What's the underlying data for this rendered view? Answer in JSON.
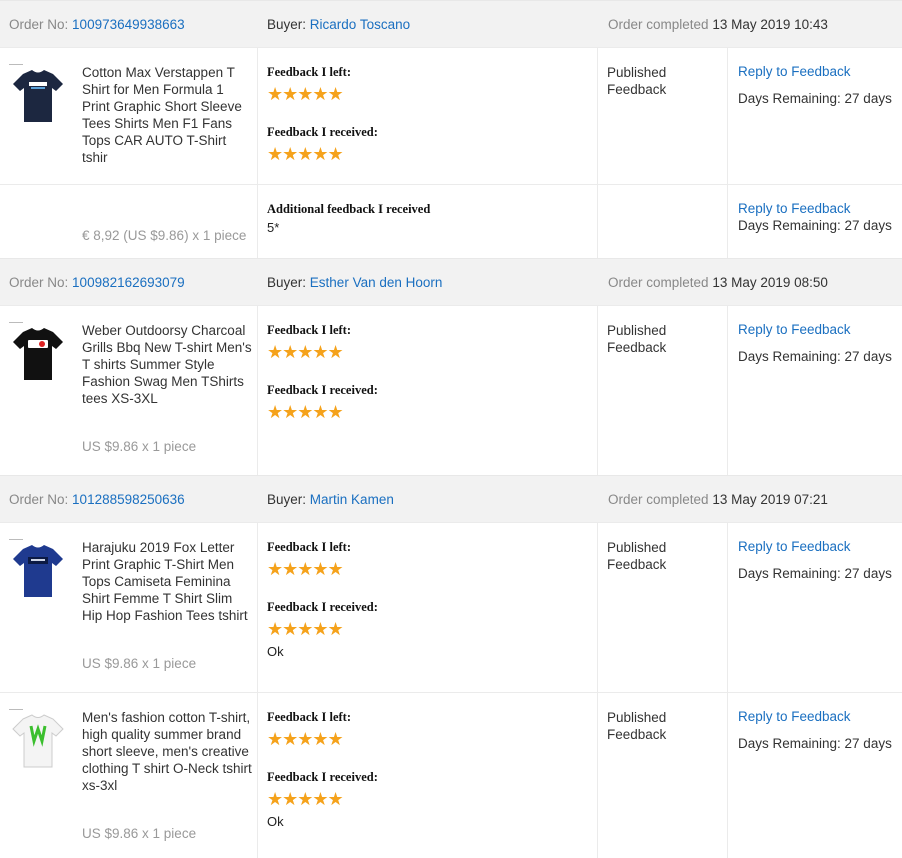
{
  "labels": {
    "order_no": "Order No:",
    "buyer": "Buyer:",
    "order_completed": "Order completed",
    "feedback_left": "Feedback I left:",
    "feedback_received": "Feedback I received:",
    "additional_feedback": "Additional feedback I received",
    "status_line1": "Published",
    "status_line2": "Feedback",
    "reply": "Reply to Feedback",
    "days_remaining": "Days Remaining: 27 days"
  },
  "colors": {
    "link": "#1a6fc0",
    "star": "#f5a21b",
    "header_bg": "#f2f2f2"
  },
  "orders": [
    {
      "order_no": "100973649938663",
      "buyer": "Ricardo Toscano",
      "completed": "13 May 2019 10:43",
      "items": [
        {
          "title": "Cotton Max Verstappen T Shirt for Men Formula 1 Print Graphic Short Sleeve Tees Shirts Men F1 Fans Tops CAR AUTO T-Shirt tshir",
          "price": "€ 8,92 (US $9.86) x 1 piece",
          "shirt_color": "navy",
          "feedback_left_stars": 5,
          "feedback_received_stars": 5,
          "additional_feedback": "5*"
        }
      ]
    },
    {
      "order_no": "100982162693079",
      "buyer": "Esther Van den Hoorn",
      "completed": "13 May 2019 08:50",
      "items": [
        {
          "title": "Weber Outdoorsy Charcoal Grills Bbq New T-shirt Men's T shirts Summer Style Fashion Swag Men TShirts tees XS-3XL",
          "price": "US $9.86 x 1 piece",
          "shirt_color": "black",
          "feedback_left_stars": 5,
          "feedback_received_stars": 5
        }
      ]
    },
    {
      "order_no": "101288598250636",
      "buyer": "Martin Kamen",
      "completed": "13 May 2019 07:21",
      "items": [
        {
          "title": "Harajuku 2019 Fox Letter Print Graphic T-Shirt Men Tops Camiseta Feminina Shirt Femme T Shirt Slim Hip Hop Fashion Tees tshirt",
          "price": "US $9.86 x 1 piece",
          "shirt_color": "royal-blue",
          "feedback_left_stars": 5,
          "feedback_received_stars": 5,
          "received_comment": "Ok"
        },
        {
          "title": "Men's fashion cotton T-shirt, high quality summer brand short sleeve, men's creative clothing T shirt O-Neck tshirt xs-3xl",
          "price": "US $9.86 x 1 piece",
          "shirt_color": "white",
          "feedback_left_stars": 5,
          "feedback_received_stars": 5,
          "received_comment": "Ok"
        }
      ]
    }
  ]
}
